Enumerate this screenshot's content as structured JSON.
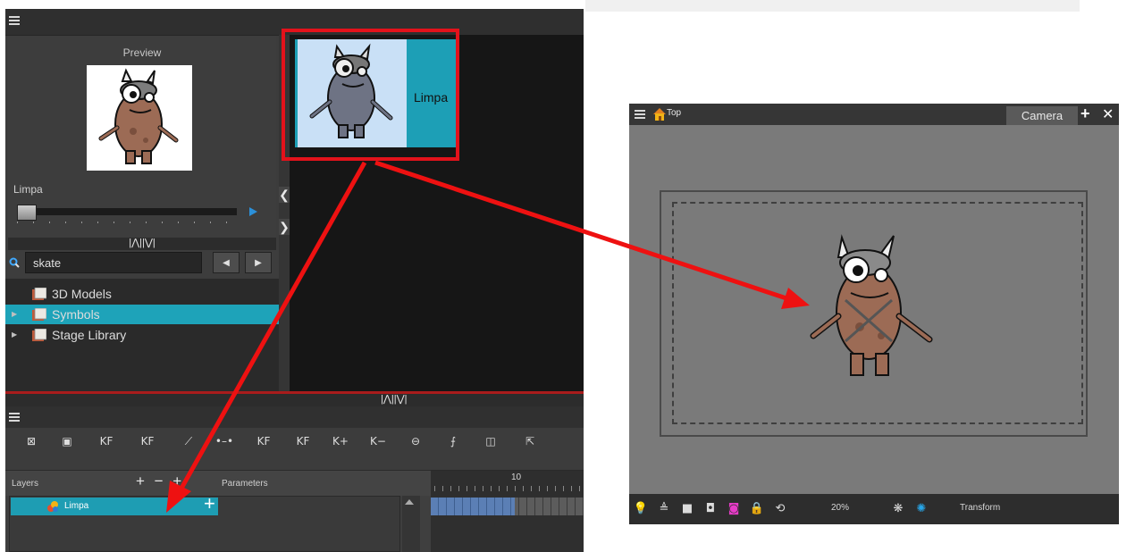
{
  "colors": {
    "accent_teal": "#1ea3b9",
    "selection_red": "#e3121b",
    "arrow_red": "#ee1111",
    "panel_dark": "#3c3c3c",
    "camera_bg": "#7a7a7a"
  },
  "library": {
    "preview_title": "Preview",
    "preview_name": "Limpa",
    "search_value": "skate",
    "search_prev_icon": "◀",
    "search_next_icon": "▶",
    "splitter_glyph": "|⋀||⋁|",
    "tree": [
      {
        "label": "3D Models",
        "icon": "folder-icon",
        "expandable": false
      },
      {
        "label": "Symbols",
        "icon": "folder-icon",
        "expandable": true,
        "selected": true
      },
      {
        "label": "Stage Library",
        "icon": "folder-icon",
        "expandable": true
      }
    ],
    "symbol_card_label": "Limpa",
    "side_chevrons": [
      "❮",
      "❯"
    ]
  },
  "timeline": {
    "layers_header": "Layers",
    "parameters_header": "Parameters",
    "layer_buttons": "+ − + ",
    "frame_number": "10",
    "layer_name": "Limpa",
    "layer_add_glyph": "+",
    "toolbar": [
      {
        "name": "add-drawing-layer-icon",
        "glyph": "⊠"
      },
      {
        "name": "add-peg-icon",
        "glyph": "▣"
      },
      {
        "name": "add-keyframe-icon",
        "glyph": "KF"
      },
      {
        "name": "remove-keyframe-icon",
        "glyph": "KF"
      },
      {
        "name": "motion-keyframe-icon",
        "glyph": "⟋"
      },
      {
        "name": "stop-motion-keyframe-icon",
        "glyph": "•–•"
      },
      {
        "name": "previous-keyframe-icon",
        "glyph": "KF"
      },
      {
        "name": "next-keyframe-icon",
        "glyph": "KF"
      },
      {
        "name": "add-key-exposure-icon",
        "glyph": "K+"
      },
      {
        "name": "remove-key-exposure-icon",
        "glyph": "K−"
      },
      {
        "name": "onion-skin-icon",
        "glyph": "⊖"
      },
      {
        "name": "ease-icon",
        "glyph": "⨍"
      },
      {
        "name": "expand-icon",
        "glyph": "◫"
      },
      {
        "name": "export-icon",
        "glyph": "⇱"
      }
    ]
  },
  "camera": {
    "title": "Top",
    "tab_label": "Camera",
    "plus_glyph": "+",
    "close_glyph": "✕",
    "zoom": "20%",
    "tool": "Transform",
    "statusbar": [
      {
        "name": "light-table-icon",
        "glyph": "💡"
      },
      {
        "name": "layer-up-icon",
        "glyph": "≜"
      },
      {
        "name": "square-icon",
        "glyph": "■"
      },
      {
        "name": "safe-area-icon",
        "glyph": "◘"
      },
      {
        "name": "onion-icon",
        "glyph": "◙"
      },
      {
        "name": "lock-icon",
        "glyph": "🔒"
      },
      {
        "name": "reset-view-icon",
        "glyph": "⟲"
      },
      {
        "name": "gear-icon",
        "glyph": "❋"
      },
      {
        "name": "render-icon",
        "glyph": "✺"
      }
    ]
  }
}
